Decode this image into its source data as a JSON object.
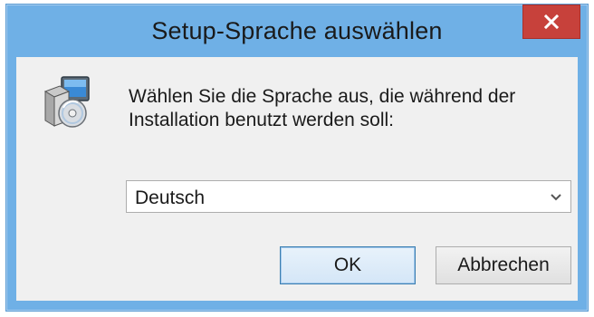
{
  "window": {
    "title": "Setup-Sprache auswählen",
    "close_icon": "close-icon",
    "app_icon": "setup-installer-icon"
  },
  "message": {
    "line1": "Wählen Sie die Sprache aus, die während der",
    "line2": "Installation benutzt werden soll:"
  },
  "language_select": {
    "selected": "Deutsch",
    "arrow_icon": "chevron-down-icon"
  },
  "buttons": {
    "ok_label": "OK",
    "cancel_label": "Abbrechen"
  },
  "colors": {
    "frame": "#6fb0e6",
    "close_button": "#c7413b",
    "client_background": "#f0f0f0",
    "default_button_border": "#3c7fb1"
  }
}
